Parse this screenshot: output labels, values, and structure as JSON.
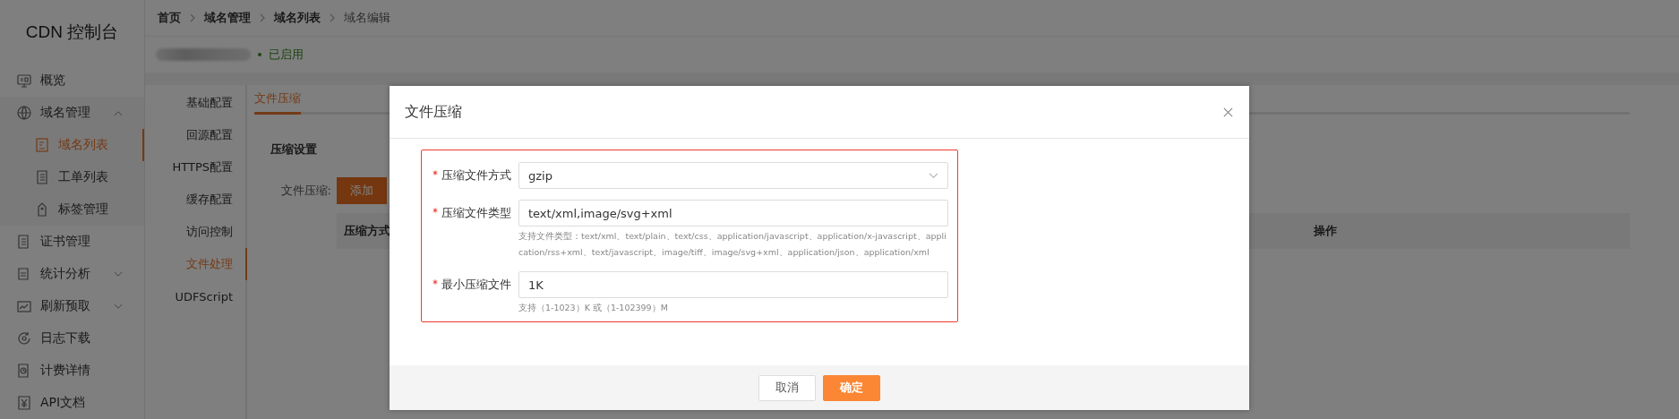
{
  "sidebar": {
    "title": "CDN 控制台",
    "items": [
      {
        "label": "概览",
        "selected": false
      },
      {
        "label": "域名管理",
        "selected": false,
        "expanded": true,
        "children": [
          {
            "label": "域名列表",
            "selected": true
          },
          {
            "label": "工单列表",
            "selected": false
          },
          {
            "label": "标签管理",
            "selected": false
          }
        ]
      },
      {
        "label": "证书管理",
        "selected": false
      },
      {
        "label": "统计分析",
        "selected": false,
        "expanded": false
      },
      {
        "label": "刷新预取",
        "selected": false,
        "expanded": false
      },
      {
        "label": "日志下载",
        "selected": false
      },
      {
        "label": "计费详情",
        "selected": false
      },
      {
        "label": "API文档",
        "selected": false
      }
    ]
  },
  "breadcrumb": [
    "首页",
    "域名管理",
    "域名列表",
    "域名编辑"
  ],
  "domain": {
    "status": "已启用"
  },
  "config_nav": [
    {
      "label": "基础配置",
      "selected": false
    },
    {
      "label": "回源配置",
      "selected": false
    },
    {
      "label": "HTTPS配置",
      "selected": false
    },
    {
      "label": "缓存配置",
      "selected": false
    },
    {
      "label": "访问控制",
      "selected": false
    },
    {
      "label": "文件处理",
      "selected": true
    },
    {
      "label": "UDFScript",
      "selected": false
    }
  ],
  "tabs": [
    {
      "label": "文件压缩",
      "selected": true
    }
  ],
  "section_title": "压缩设置",
  "field_label": "文件压缩:",
  "add_button": "添加",
  "table": {
    "columns": [
      "压缩方式",
      "操作"
    ]
  },
  "modal": {
    "title": "文件压缩",
    "fields": [
      {
        "kind": "select",
        "label": "压缩文件方式",
        "required": true,
        "value": "gzip"
      },
      {
        "kind": "input",
        "label": "压缩文件类型",
        "required": true,
        "value": "text/xml,image/svg+xml",
        "help": "支持文件类型：text/xml、text/plain、text/css、application/javascript、application/x-javascript、application/rss+xml、text/javascript、image/tiff、image/svg+xml、application/json、application/xml"
      },
      {
        "kind": "input",
        "label": "最小压缩文件",
        "required": true,
        "value": "1K",
        "help": "支持（1-1023）K 或（1-102399）M"
      }
    ],
    "buttons": [
      {
        "label": "取消",
        "kind": "default"
      },
      {
        "label": "确定",
        "kind": "primary"
      }
    ]
  }
}
